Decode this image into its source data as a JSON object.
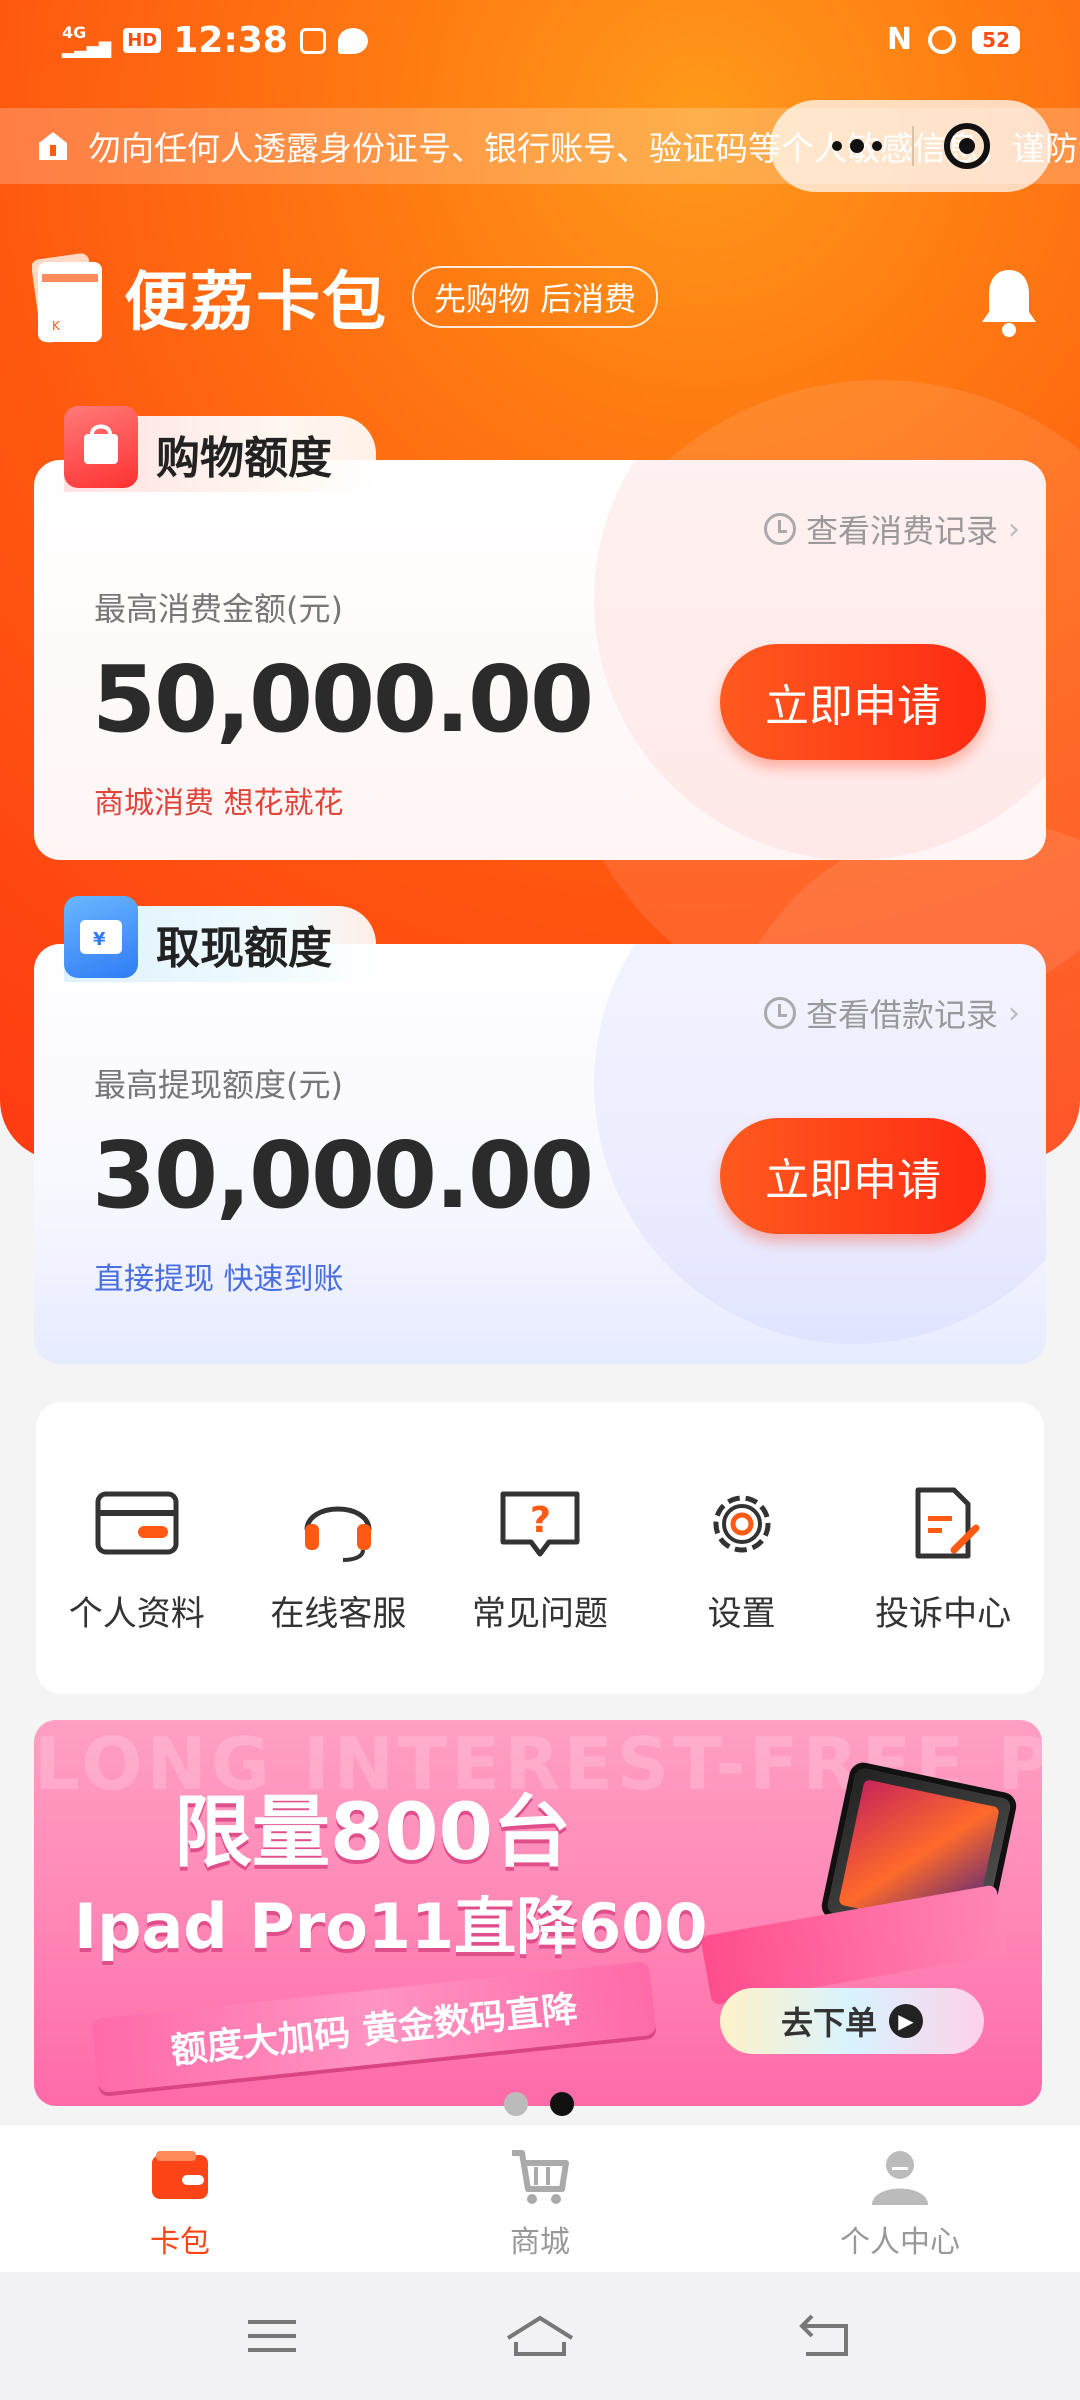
{
  "status_bar": {
    "network": "4G",
    "hd": "HD",
    "time": "12:38",
    "nfc": "N",
    "battery": "52"
  },
  "notice": {
    "text": "勿向任何人透露身份证号、银行账号、验证码等个人敏感信息，谨防诈骗！"
  },
  "brand": {
    "name": "便荔卡包",
    "slogan": "先购物 后消费"
  },
  "shop_card": {
    "tab": "购物额度",
    "record": "查看消费记录",
    "amount_label": "最高消费金额(元)",
    "amount": "50,000.00",
    "subtitle": "商城消费 想花就花",
    "apply": "立即申请"
  },
  "cash_card": {
    "tab": "取现额度",
    "record": "查看借款记录",
    "amount_label": "最高提现额度(元)",
    "amount": "30,000.00",
    "subtitle": "直接提现 快速到账",
    "apply": "立即申请"
  },
  "grid": [
    {
      "label": "个人资料",
      "icon": "card-icon"
    },
    {
      "label": "在线客服",
      "icon": "headset-icon"
    },
    {
      "label": "常见问题",
      "icon": "question-icon"
    },
    {
      "label": "设置",
      "icon": "gear-icon"
    },
    {
      "label": "投诉中心",
      "icon": "document-edit-icon"
    }
  ],
  "banner": {
    "bg_text": "LONG INTEREST-FREE P",
    "line1": "限量800台",
    "line2": "Ipad Pro11直降600",
    "ribbon": "额度大加码 黄金数码直降",
    "button": "去下单"
  },
  "carousel": {
    "count": 2,
    "active": 2
  },
  "tabbar": [
    {
      "label": "卡包",
      "active": true
    },
    {
      "label": "商城",
      "active": false
    },
    {
      "label": "个人中心",
      "active": false
    }
  ],
  "colors": {
    "accent": "#ff4417",
    "hero_start": "#ff3a12",
    "hero_end": "#ff9a1a",
    "cash_sub": "#4a6ee0",
    "shop_sub": "#e0443a"
  }
}
